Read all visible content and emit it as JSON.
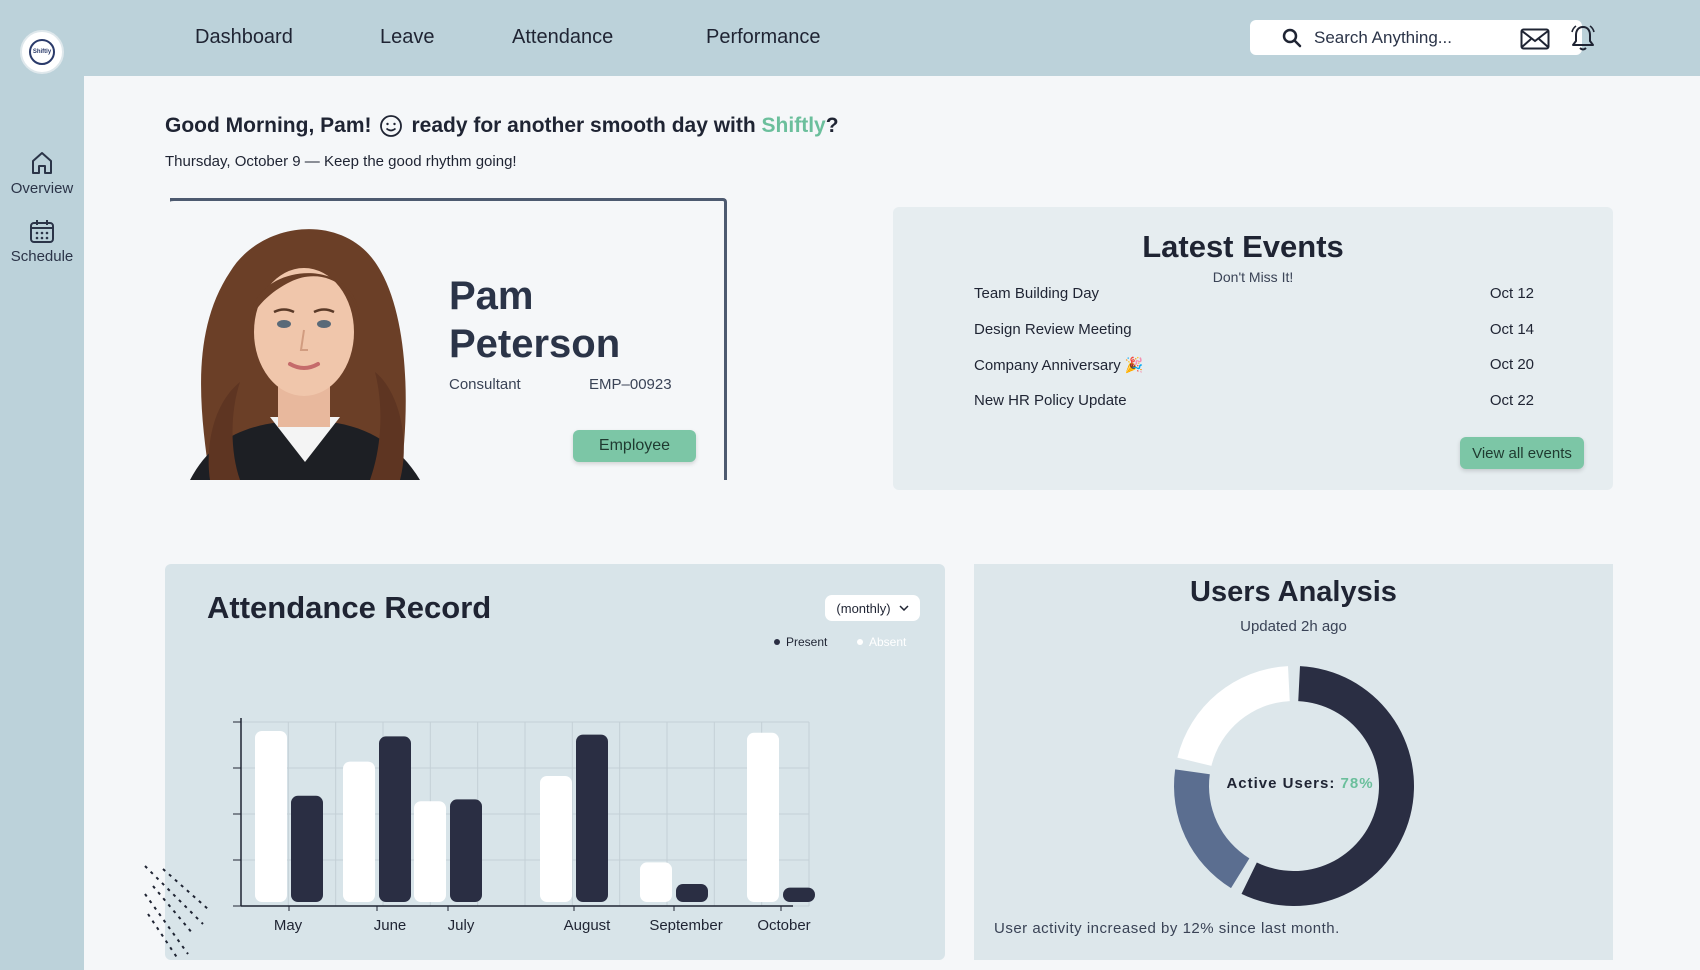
{
  "brand": {
    "logo_text": "Shiftly"
  },
  "sidebar": {
    "items": [
      {
        "label": "Overview",
        "icon": "home-icon"
      },
      {
        "label": "Schedule",
        "icon": "calendar-icon"
      }
    ]
  },
  "nav": {
    "items": [
      "Dashboard",
      "Leave",
      "Attendance",
      "Performance"
    ]
  },
  "search": {
    "placeholder": "Search Anything..."
  },
  "greeting": {
    "prefix": "Good Morning, Pam!",
    "middle": "ready for another smooth day with",
    "brand": "Shiftly",
    "suffix": "?",
    "subtitle": "Thursday, October 9 — Keep the good rhythm going!"
  },
  "profile": {
    "first_name": "Pam",
    "last_name": "Peterson",
    "role": "Consultant",
    "employee_id": "EMP–00923",
    "badge": "Employee"
  },
  "events": {
    "title": "Latest Events",
    "subtitle": "Don't Miss It!",
    "items": [
      {
        "name": "Team Building Day",
        "date": "Oct 12"
      },
      {
        "name": "Design Review Meeting",
        "date": "Oct 14"
      },
      {
        "name": "Company Anniversary 🎉",
        "date": "Oct 20"
      },
      {
        "name": "New HR Policy Update",
        "date": "Oct 22"
      }
    ],
    "button": "View all events"
  },
  "attendance": {
    "title": "Attendance Record",
    "period": "(monthly)",
    "legend_present": "Present",
    "legend_absent": "Absent"
  },
  "chart_data": {
    "type": "bar",
    "categories": [
      "May",
      "June",
      "July",
      "August",
      "September",
      "October"
    ],
    "series": [
      {
        "name": "Present",
        "color": "#ffffff",
        "values": [
          95,
          78,
          56,
          70,
          22,
          94
        ]
      },
      {
        "name": "Absent",
        "color": "#2a2e43",
        "values": [
          59,
          92,
          57,
          93,
          10,
          8
        ]
      }
    ],
    "ylim": [
      0,
      100
    ],
    "grid": true
  },
  "users": {
    "title": "Users Analysis",
    "updated": "Updated 2h ago",
    "center_label": "Active Users:",
    "center_value": "78%",
    "footer": "User activity increased by 12% since last month.",
    "segments": [
      {
        "name": "dark",
        "value": 58,
        "color": "#2a2e43"
      },
      {
        "name": "slate",
        "value": 20,
        "color": "#5b6e90"
      },
      {
        "name": "white",
        "value": 22,
        "color": "#ffffff"
      }
    ]
  }
}
